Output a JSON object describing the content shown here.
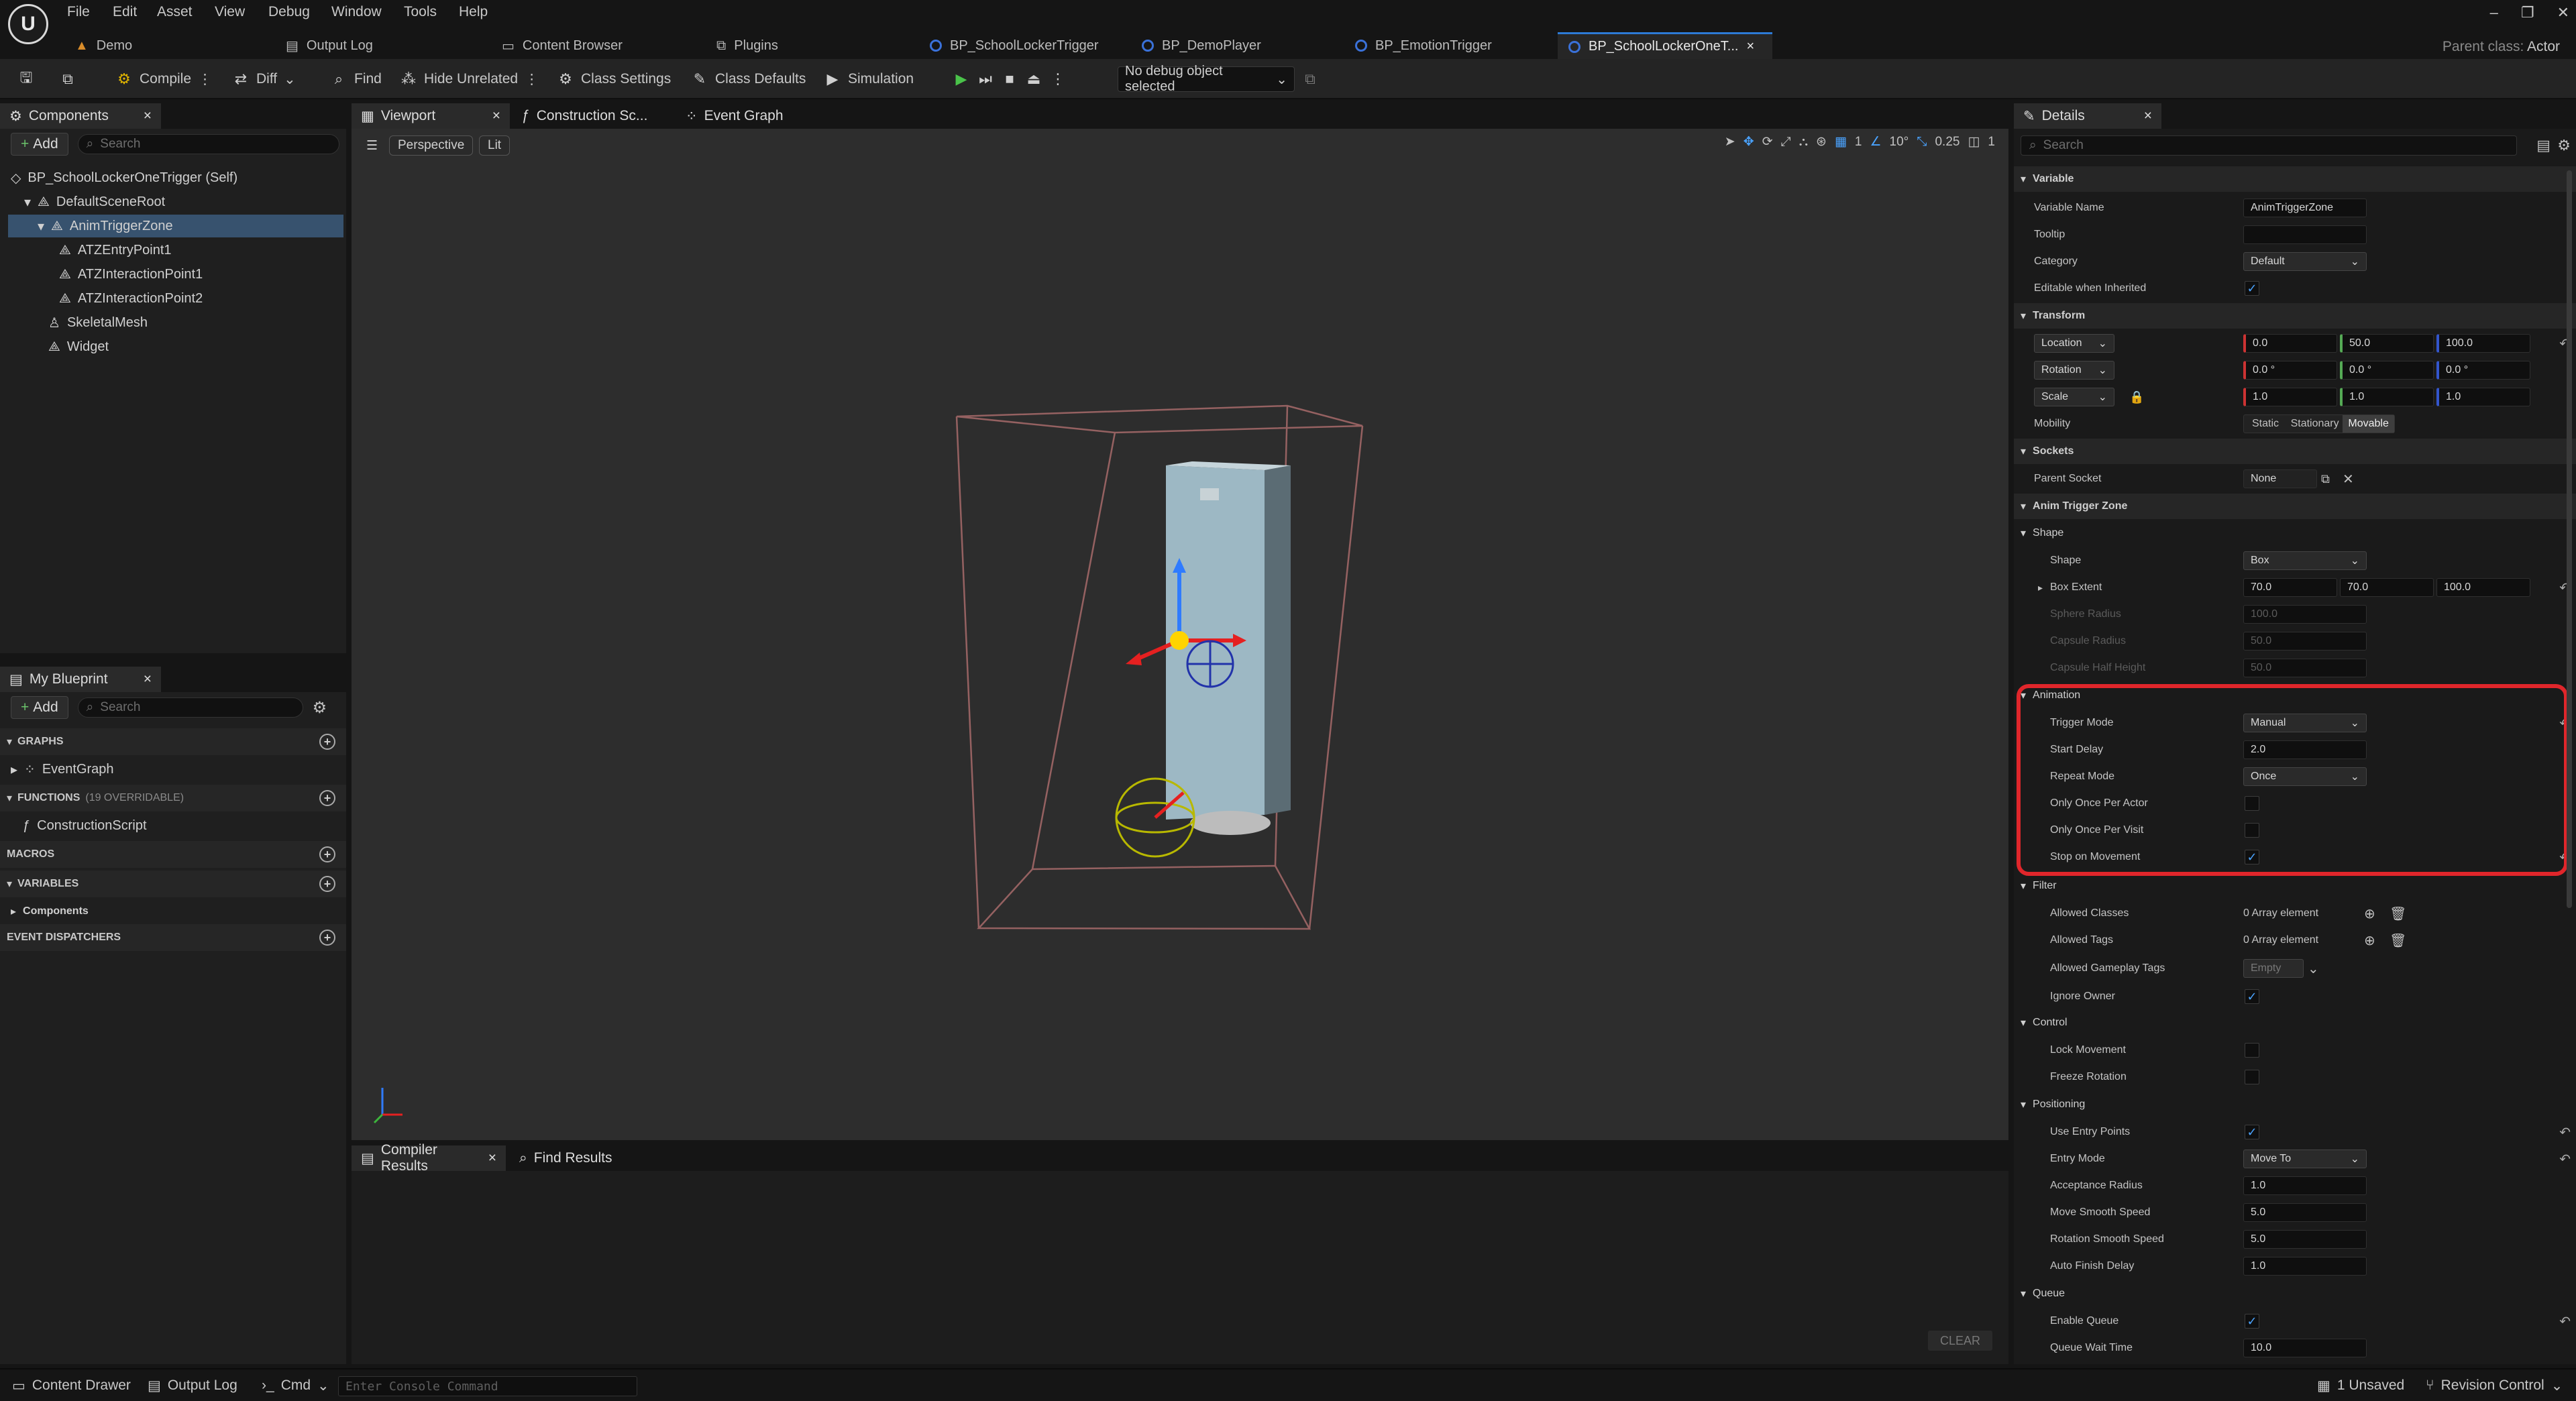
{
  "menubar": {
    "items": [
      "File",
      "Edit",
      "Asset",
      "View",
      "Debug",
      "Window",
      "Tools",
      "Help"
    ]
  },
  "tabs": [
    {
      "label": "Demo",
      "icon": "level-icon"
    },
    {
      "label": "Output Log",
      "icon": "log-icon"
    },
    {
      "label": "Content Browser",
      "icon": "folder-icon"
    },
    {
      "label": "Plugins",
      "icon": "plugin-icon"
    },
    {
      "label": "BP_SchoolLockerTrigger",
      "icon": "blueprint-icon"
    },
    {
      "label": "BP_DemoPlayer",
      "icon": "blueprint-icon"
    },
    {
      "label": "BP_EmotionTrigger",
      "icon": "blueprint-icon"
    },
    {
      "label": "BP_SchoolLockerOneT...",
      "icon": "blueprint-icon"
    }
  ],
  "parent_class": {
    "label": "Parent class:",
    "value": "Actor"
  },
  "toolbar": {
    "compile": "Compile",
    "diff": "Diff",
    "find": "Find",
    "hide_unrelated": "Hide Unrelated",
    "class_settings": "Class Settings",
    "class_defaults": "Class Defaults",
    "simulation": "Simulation",
    "debug_object": "No debug object selected"
  },
  "components": {
    "title": "Components",
    "add": "Add",
    "search_placeholder": "Search",
    "items": [
      {
        "label": "BP_SchoolLockerOneTrigger (Self)"
      },
      {
        "label": "DefaultSceneRoot"
      },
      {
        "label": "AnimTriggerZone"
      },
      {
        "label": "ATZEntryPoint1"
      },
      {
        "label": "ATZInteractionPoint1"
      },
      {
        "label": "ATZInteractionPoint2"
      },
      {
        "label": "SkeletalMesh"
      },
      {
        "label": "Widget"
      }
    ]
  },
  "my_blueprint": {
    "title": "My Blueprint",
    "add": "Add",
    "search_placeholder": "Search",
    "graphs": "GRAPHS",
    "event_graph": "EventGraph",
    "functions": "FUNCTIONS",
    "functions_count": "(19 OVERRIDABLE)",
    "construction_script": "ConstructionScript",
    "macros": "MACROS",
    "variables": "VARIABLES",
    "components": "Components",
    "event_dispatchers": "EVENT DISPATCHERS"
  },
  "editor_tabs": {
    "viewport": "Viewport",
    "construction": "Construction Sc...",
    "event_graph": "Event Graph"
  },
  "viewport": {
    "perspective": "Perspective",
    "lit": "Lit",
    "grid": "1",
    "angle": "10°",
    "scale": "0.25",
    "camera": "1"
  },
  "bottom_tabs": {
    "compiler_results": "Compiler Results",
    "find_results": "Find Results",
    "clear": "CLEAR"
  },
  "details": {
    "title": "Details",
    "search_placeholder": "Search",
    "variable": {
      "section": "Variable",
      "name_label": "Variable Name",
      "name_value": "AnimTriggerZone",
      "tooltip_label": "Tooltip",
      "category_label": "Category",
      "category_value": "Default",
      "editable_label": "Editable when Inherited"
    },
    "transform": {
      "section": "Transform",
      "location": "Location",
      "rotation": "Rotation",
      "scale": "Scale",
      "loc": [
        "0.0",
        "50.0",
        "100.0"
      ],
      "rot": [
        "0.0 °",
        "0.0 °",
        "0.0 °"
      ],
      "scl": [
        "1.0",
        "1.0",
        "1.0"
      ],
      "mobility": "Mobility",
      "static": "Static",
      "stationary": "Stationary",
      "movable": "Movable"
    },
    "sockets": {
      "section": "Sockets",
      "parent_socket": "Parent Socket",
      "none": "None"
    },
    "anim_trigger_zone": "Anim Trigger Zone",
    "shape": {
      "section": "Shape",
      "shape_label": "Shape",
      "shape_value": "Box",
      "box_extent": "Box Extent",
      "extent": [
        "70.0",
        "70.0",
        "100.0"
      ],
      "sphere_radius": "Sphere Radius",
      "sphere_value": "100.0",
      "capsule_radius": "Capsule Radius",
      "capsule_value": "50.0",
      "capsule_half": "Capsule Half Height",
      "capsule_half_value": "50.0"
    },
    "animation": {
      "section": "Animation",
      "trigger_mode": "Trigger Mode",
      "trigger_value": "Manual",
      "start_delay": "Start Delay",
      "start_delay_value": "2.0",
      "repeat_mode": "Repeat Mode",
      "repeat_value": "Once",
      "once_actor": "Only Once Per Actor",
      "once_visit": "Only Once Per Visit",
      "stop_movement": "Stop on Movement"
    },
    "filter": {
      "section": "Filter",
      "allowed_classes": "Allowed Classes",
      "allowed_classes_value": "0 Array element",
      "allowed_tags": "Allowed Tags",
      "allowed_tags_value": "0 Array element",
      "allowed_gameplay": "Allowed Gameplay Tags",
      "gameplay_value": "Empty",
      "ignore_owner": "Ignore Owner"
    },
    "control": {
      "section": "Control",
      "lock_movement": "Lock Movement",
      "freeze_rotation": "Freeze Rotation"
    },
    "positioning": {
      "section": "Positioning",
      "use_entry": "Use Entry Points",
      "entry_mode": "Entry Mode",
      "entry_value": "Move To",
      "acceptance": "Acceptance Radius",
      "acceptance_value": "1.0",
      "move_speed": "Move Smooth Speed",
      "move_value": "5.0",
      "rot_speed": "Rotation Smooth Speed",
      "rot_value": "5.0",
      "auto_finish": "Auto Finish Delay",
      "auto_value": "1.0"
    },
    "queue": {
      "section": "Queue",
      "enable": "Enable Queue",
      "wait": "Queue Wait Time",
      "wait_value": "10.0"
    }
  },
  "statusbar": {
    "content_drawer": "Content Drawer",
    "output_log": "Output Log",
    "cmd": "Cmd",
    "console_placeholder": "Enter Console Command",
    "unsaved": "1 Unsaved",
    "revision": "Revision Control"
  },
  "colors": {
    "accent": "#2d7ad6",
    "highlight": "#e0262b",
    "selection": "#37526e"
  }
}
